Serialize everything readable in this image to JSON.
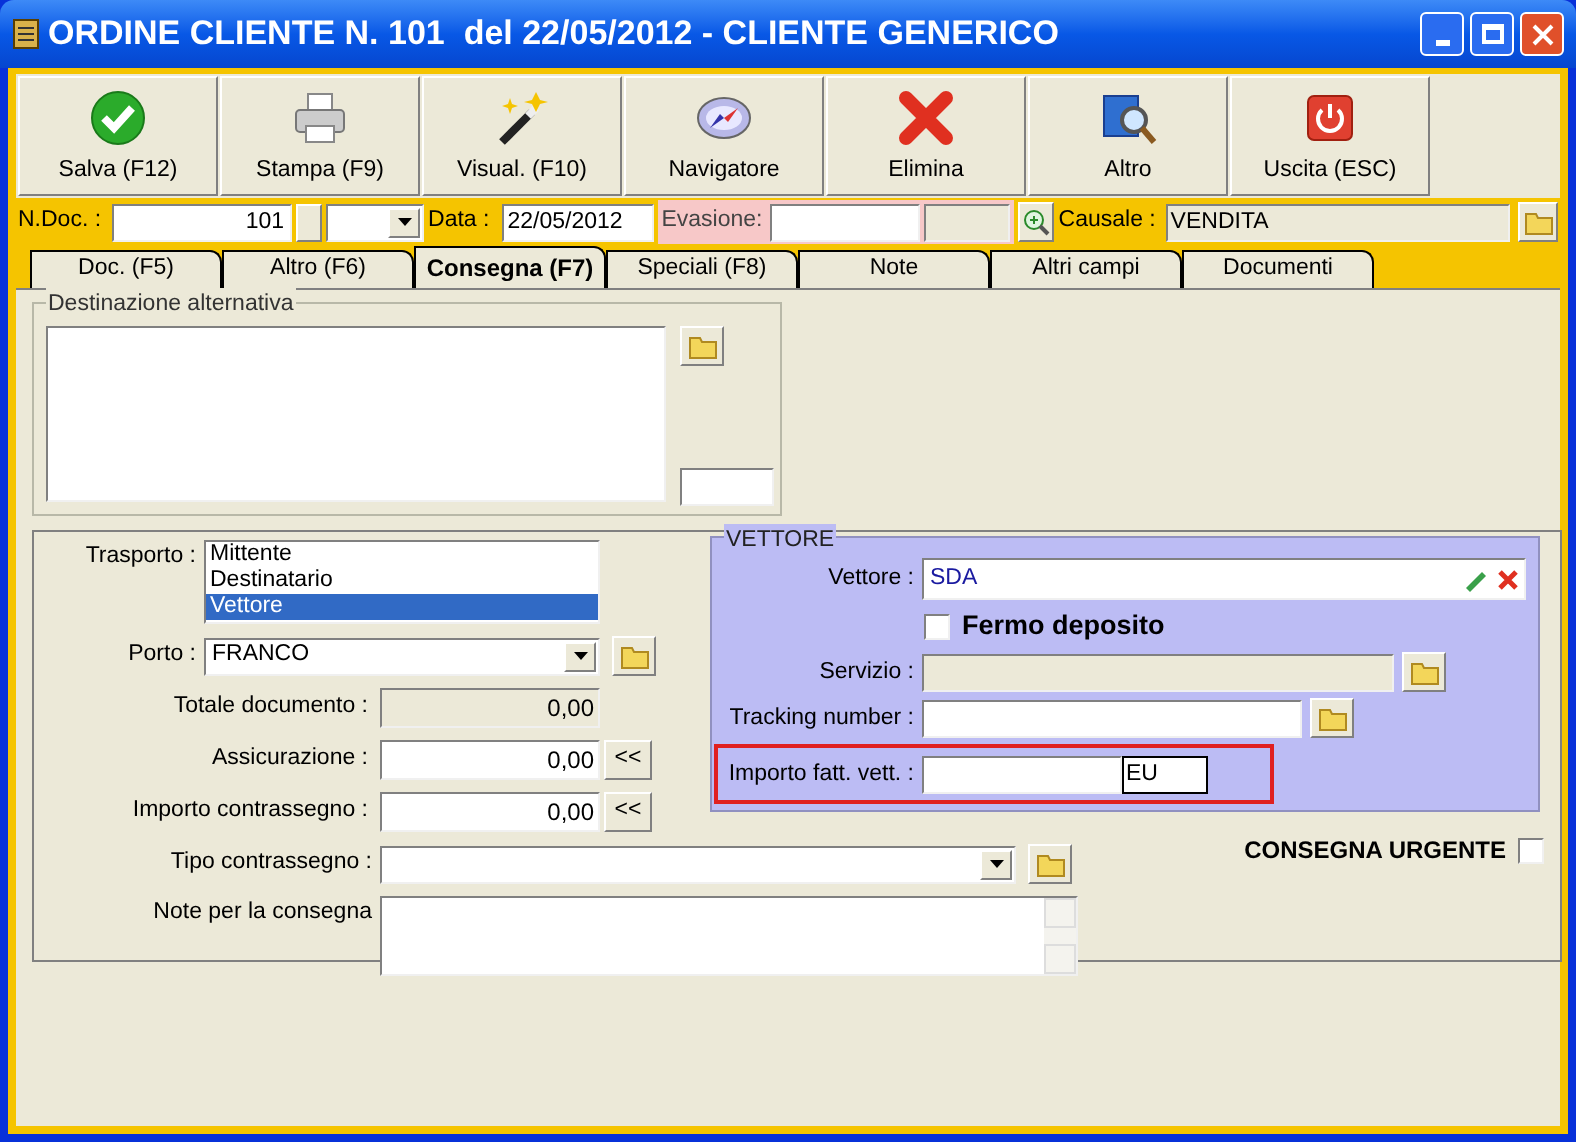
{
  "window": {
    "title": "ORDINE CLIENTE N. 101  del 22/05/2012 - CLIENTE GENERICO"
  },
  "toolbar": [
    {
      "label": "Salva (F12)",
      "kind": "save"
    },
    {
      "label": "Stampa (F9)",
      "kind": "print"
    },
    {
      "label": "Visual. (F10)",
      "kind": "wand"
    },
    {
      "label": "Navigatore",
      "kind": "compass"
    },
    {
      "label": "Elimina",
      "kind": "delete"
    },
    {
      "label": "Altro",
      "kind": "search"
    },
    {
      "label": "Uscita (ESC)",
      "kind": "exit"
    }
  ],
  "header": {
    "ndoc": {
      "label": "N.Doc. :",
      "value": "101"
    },
    "data": {
      "label": "Data :",
      "value": "22/05/2012"
    },
    "evasione": {
      "label": "Evasione:"
    },
    "causale": {
      "label": "Causale :",
      "value": "VENDITA"
    }
  },
  "tabs": [
    {
      "label": "Doc. (F5)",
      "selected": false
    },
    {
      "label": "Altro (F6)",
      "selected": false
    },
    {
      "label": "Consegna (F7)",
      "selected": true
    },
    {
      "label": "Speciali (F8)",
      "selected": false
    },
    {
      "label": "Note",
      "selected": false
    },
    {
      "label": "Altri campi",
      "selected": false
    },
    {
      "label": "Documenti",
      "selected": false
    }
  ],
  "destinazione": {
    "title": "Destinazione alternativa"
  },
  "trasporto": {
    "label": "Trasporto :",
    "options": [
      {
        "label": "Mittente",
        "selected": false
      },
      {
        "label": "Destinatario",
        "selected": false
      },
      {
        "label": "Vettore",
        "selected": true
      }
    ]
  },
  "porto": {
    "label": "Porto :",
    "value": "FRANCO"
  },
  "totale": {
    "label": "Totale documento :",
    "value": "0,00"
  },
  "assicurazione": {
    "label": "Assicurazione :",
    "value": "0,00",
    "button": "<<"
  },
  "importo_contrassegno": {
    "label": "Importo contrassegno :",
    "value": "0,00",
    "button": "<<"
  },
  "tipo_contrassegno": {
    "label": "Tipo contrassegno :"
  },
  "note": {
    "label": "Note per la consegna"
  },
  "vettore": {
    "title": "VETTORE",
    "vettore": {
      "label": "Vettore :",
      "value": "SDA"
    },
    "fermo_deposito": {
      "label": "Fermo deposito",
      "checked": false
    },
    "servizio": {
      "label": "Servizio :"
    },
    "tracking": {
      "label": "Tracking number :"
    },
    "importo_fatt": {
      "label": "Importo fatt. vett. :",
      "currency": "EU",
      "highlighted": true
    }
  },
  "consegna_urgente": {
    "label": "CONSEGNA URGENTE",
    "checked": false
  }
}
